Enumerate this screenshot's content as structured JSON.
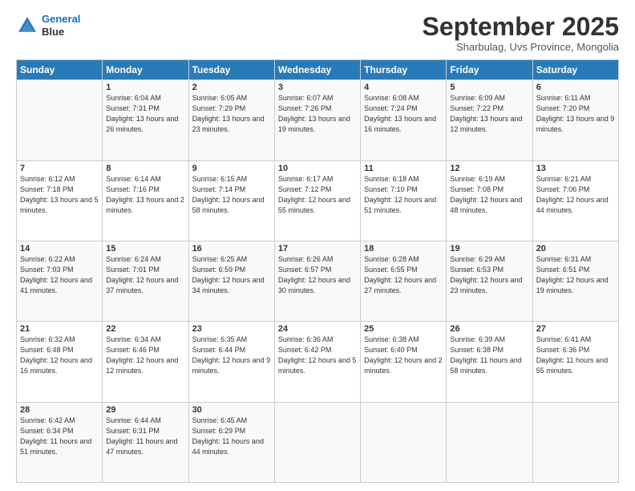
{
  "header": {
    "logo_line1": "General",
    "logo_line2": "Blue",
    "month_title": "September 2025",
    "location": "Sharbulag, Uvs Province, Mongolia"
  },
  "weekdays": [
    "Sunday",
    "Monday",
    "Tuesday",
    "Wednesday",
    "Thursday",
    "Friday",
    "Saturday"
  ],
  "weeks": [
    [
      {
        "day": "",
        "sunrise": "",
        "sunset": "",
        "daylight": ""
      },
      {
        "day": "1",
        "sunrise": "Sunrise: 6:04 AM",
        "sunset": "Sunset: 7:31 PM",
        "daylight": "Daylight: 13 hours and 26 minutes."
      },
      {
        "day": "2",
        "sunrise": "Sunrise: 6:05 AM",
        "sunset": "Sunset: 7:29 PM",
        "daylight": "Daylight: 13 hours and 23 minutes."
      },
      {
        "day": "3",
        "sunrise": "Sunrise: 6:07 AM",
        "sunset": "Sunset: 7:26 PM",
        "daylight": "Daylight: 13 hours and 19 minutes."
      },
      {
        "day": "4",
        "sunrise": "Sunrise: 6:08 AM",
        "sunset": "Sunset: 7:24 PM",
        "daylight": "Daylight: 13 hours and 16 minutes."
      },
      {
        "day": "5",
        "sunrise": "Sunrise: 6:09 AM",
        "sunset": "Sunset: 7:22 PM",
        "daylight": "Daylight: 13 hours and 12 minutes."
      },
      {
        "day": "6",
        "sunrise": "Sunrise: 6:11 AM",
        "sunset": "Sunset: 7:20 PM",
        "daylight": "Daylight: 13 hours and 9 minutes."
      }
    ],
    [
      {
        "day": "7",
        "sunrise": "Sunrise: 6:12 AM",
        "sunset": "Sunset: 7:18 PM",
        "daylight": "Daylight: 13 hours and 5 minutes."
      },
      {
        "day": "8",
        "sunrise": "Sunrise: 6:14 AM",
        "sunset": "Sunset: 7:16 PM",
        "daylight": "Daylight: 13 hours and 2 minutes."
      },
      {
        "day": "9",
        "sunrise": "Sunrise: 6:15 AM",
        "sunset": "Sunset: 7:14 PM",
        "daylight": "Daylight: 12 hours and 58 minutes."
      },
      {
        "day": "10",
        "sunrise": "Sunrise: 6:17 AM",
        "sunset": "Sunset: 7:12 PM",
        "daylight": "Daylight: 12 hours and 55 minutes."
      },
      {
        "day": "11",
        "sunrise": "Sunrise: 6:18 AM",
        "sunset": "Sunset: 7:10 PM",
        "daylight": "Daylight: 12 hours and 51 minutes."
      },
      {
        "day": "12",
        "sunrise": "Sunrise: 6:19 AM",
        "sunset": "Sunset: 7:08 PM",
        "daylight": "Daylight: 12 hours and 48 minutes."
      },
      {
        "day": "13",
        "sunrise": "Sunrise: 6:21 AM",
        "sunset": "Sunset: 7:06 PM",
        "daylight": "Daylight: 12 hours and 44 minutes."
      }
    ],
    [
      {
        "day": "14",
        "sunrise": "Sunrise: 6:22 AM",
        "sunset": "Sunset: 7:03 PM",
        "daylight": "Daylight: 12 hours and 41 minutes."
      },
      {
        "day": "15",
        "sunrise": "Sunrise: 6:24 AM",
        "sunset": "Sunset: 7:01 PM",
        "daylight": "Daylight: 12 hours and 37 minutes."
      },
      {
        "day": "16",
        "sunrise": "Sunrise: 6:25 AM",
        "sunset": "Sunset: 6:59 PM",
        "daylight": "Daylight: 12 hours and 34 minutes."
      },
      {
        "day": "17",
        "sunrise": "Sunrise: 6:26 AM",
        "sunset": "Sunset: 6:57 PM",
        "daylight": "Daylight: 12 hours and 30 minutes."
      },
      {
        "day": "18",
        "sunrise": "Sunrise: 6:28 AM",
        "sunset": "Sunset: 6:55 PM",
        "daylight": "Daylight: 12 hours and 27 minutes."
      },
      {
        "day": "19",
        "sunrise": "Sunrise: 6:29 AM",
        "sunset": "Sunset: 6:53 PM",
        "daylight": "Daylight: 12 hours and 23 minutes."
      },
      {
        "day": "20",
        "sunrise": "Sunrise: 6:31 AM",
        "sunset": "Sunset: 6:51 PM",
        "daylight": "Daylight: 12 hours and 19 minutes."
      }
    ],
    [
      {
        "day": "21",
        "sunrise": "Sunrise: 6:32 AM",
        "sunset": "Sunset: 6:48 PM",
        "daylight": "Daylight: 12 hours and 16 minutes."
      },
      {
        "day": "22",
        "sunrise": "Sunrise: 6:34 AM",
        "sunset": "Sunset: 6:46 PM",
        "daylight": "Daylight: 12 hours and 12 minutes."
      },
      {
        "day": "23",
        "sunrise": "Sunrise: 6:35 AM",
        "sunset": "Sunset: 6:44 PM",
        "daylight": "Daylight: 12 hours and 9 minutes."
      },
      {
        "day": "24",
        "sunrise": "Sunrise: 6:36 AM",
        "sunset": "Sunset: 6:42 PM",
        "daylight": "Daylight: 12 hours and 5 minutes."
      },
      {
        "day": "25",
        "sunrise": "Sunrise: 6:38 AM",
        "sunset": "Sunset: 6:40 PM",
        "daylight": "Daylight: 12 hours and 2 minutes."
      },
      {
        "day": "26",
        "sunrise": "Sunrise: 6:39 AM",
        "sunset": "Sunset: 6:38 PM",
        "daylight": "Daylight: 11 hours and 58 minutes."
      },
      {
        "day": "27",
        "sunrise": "Sunrise: 6:41 AM",
        "sunset": "Sunset: 6:36 PM",
        "daylight": "Daylight: 11 hours and 55 minutes."
      }
    ],
    [
      {
        "day": "28",
        "sunrise": "Sunrise: 6:42 AM",
        "sunset": "Sunset: 6:34 PM",
        "daylight": "Daylight: 11 hours and 51 minutes."
      },
      {
        "day": "29",
        "sunrise": "Sunrise: 6:44 AM",
        "sunset": "Sunset: 6:31 PM",
        "daylight": "Daylight: 11 hours and 47 minutes."
      },
      {
        "day": "30",
        "sunrise": "Sunrise: 6:45 AM",
        "sunset": "Sunset: 6:29 PM",
        "daylight": "Daylight: 11 hours and 44 minutes."
      },
      {
        "day": "",
        "sunrise": "",
        "sunset": "",
        "daylight": ""
      },
      {
        "day": "",
        "sunrise": "",
        "sunset": "",
        "daylight": ""
      },
      {
        "day": "",
        "sunrise": "",
        "sunset": "",
        "daylight": ""
      },
      {
        "day": "",
        "sunrise": "",
        "sunset": "",
        "daylight": ""
      }
    ]
  ]
}
